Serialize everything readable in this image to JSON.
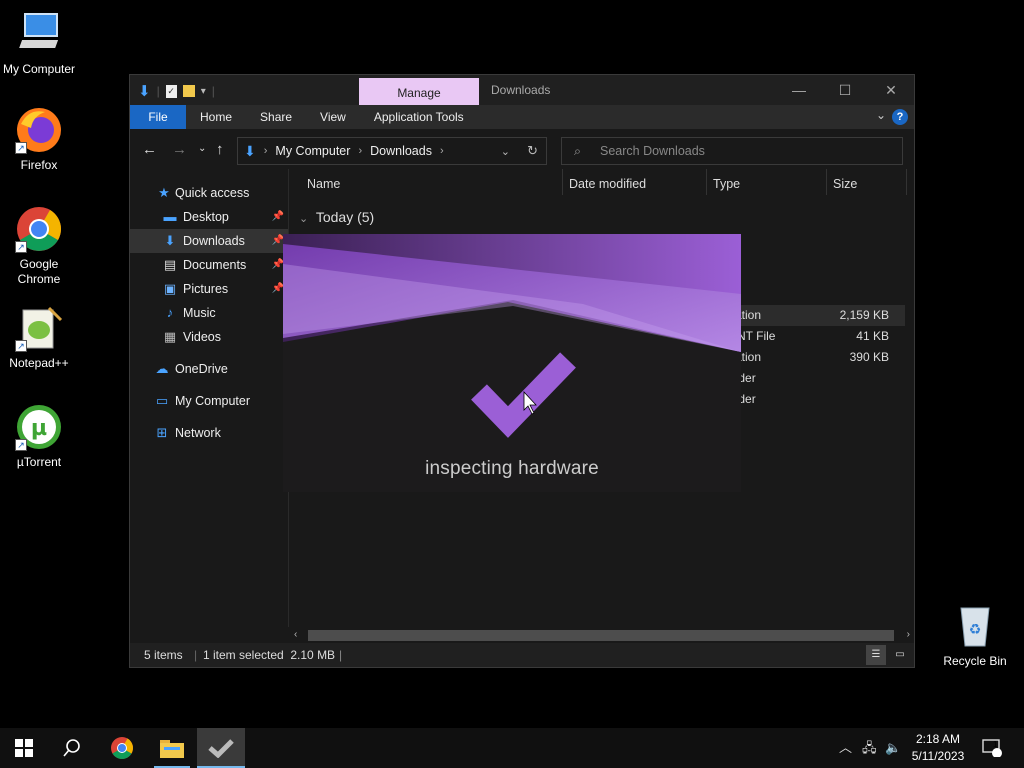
{
  "desktop": {
    "icons": [
      {
        "label": "My Computer"
      },
      {
        "label": "Firefox"
      },
      {
        "label": "Google Chrome"
      },
      {
        "label": "Notepad++"
      },
      {
        "label": "µTorrent"
      },
      {
        "label": "Recycle Bin"
      }
    ]
  },
  "explorer": {
    "manage_tab": "Manage",
    "title": "Downloads",
    "ribbon_tabs": [
      "File",
      "Home",
      "Share",
      "View",
      "Application Tools"
    ],
    "address": {
      "parts": [
        "My Computer",
        "Downloads"
      ]
    },
    "search": {
      "placeholder": "Search Downloads"
    },
    "sidebar": [
      {
        "label": "Quick access",
        "icon": "star-icon"
      },
      {
        "label": "Desktop",
        "icon": "desktop-folder-icon"
      },
      {
        "label": "Downloads",
        "icon": "download-arrow-icon"
      },
      {
        "label": "Documents",
        "icon": "documents-icon"
      },
      {
        "label": "Pictures",
        "icon": "pictures-icon"
      },
      {
        "label": "Music",
        "icon": "music-icon"
      },
      {
        "label": "Videos",
        "icon": "videos-icon"
      },
      {
        "label": "OneDrive",
        "icon": "cloud-icon"
      },
      {
        "label": "My Computer",
        "icon": "computer-icon"
      },
      {
        "label": "Network",
        "icon": "network-icon"
      }
    ],
    "columns": [
      "Name",
      "Date modified",
      "Type",
      "Size"
    ],
    "group": "Today (5)",
    "rows": [
      {
        "type": "cation",
        "size": "2,159 KB"
      },
      {
        "type": "ENT File",
        "size": "41 KB"
      },
      {
        "type": "cation",
        "size": "390 KB"
      },
      {
        "type": "older",
        "size": ""
      },
      {
        "type": "older",
        "size": ""
      }
    ],
    "status": {
      "items": "5 items",
      "selected": "1 item selected  2.10 MB"
    }
  },
  "splash": {
    "text": "inspecting hardware",
    "accent": "#9b5fd6"
  },
  "taskbar": {
    "time": "2:18 AM",
    "date": "5/11/2023",
    "notif_count": "1"
  }
}
